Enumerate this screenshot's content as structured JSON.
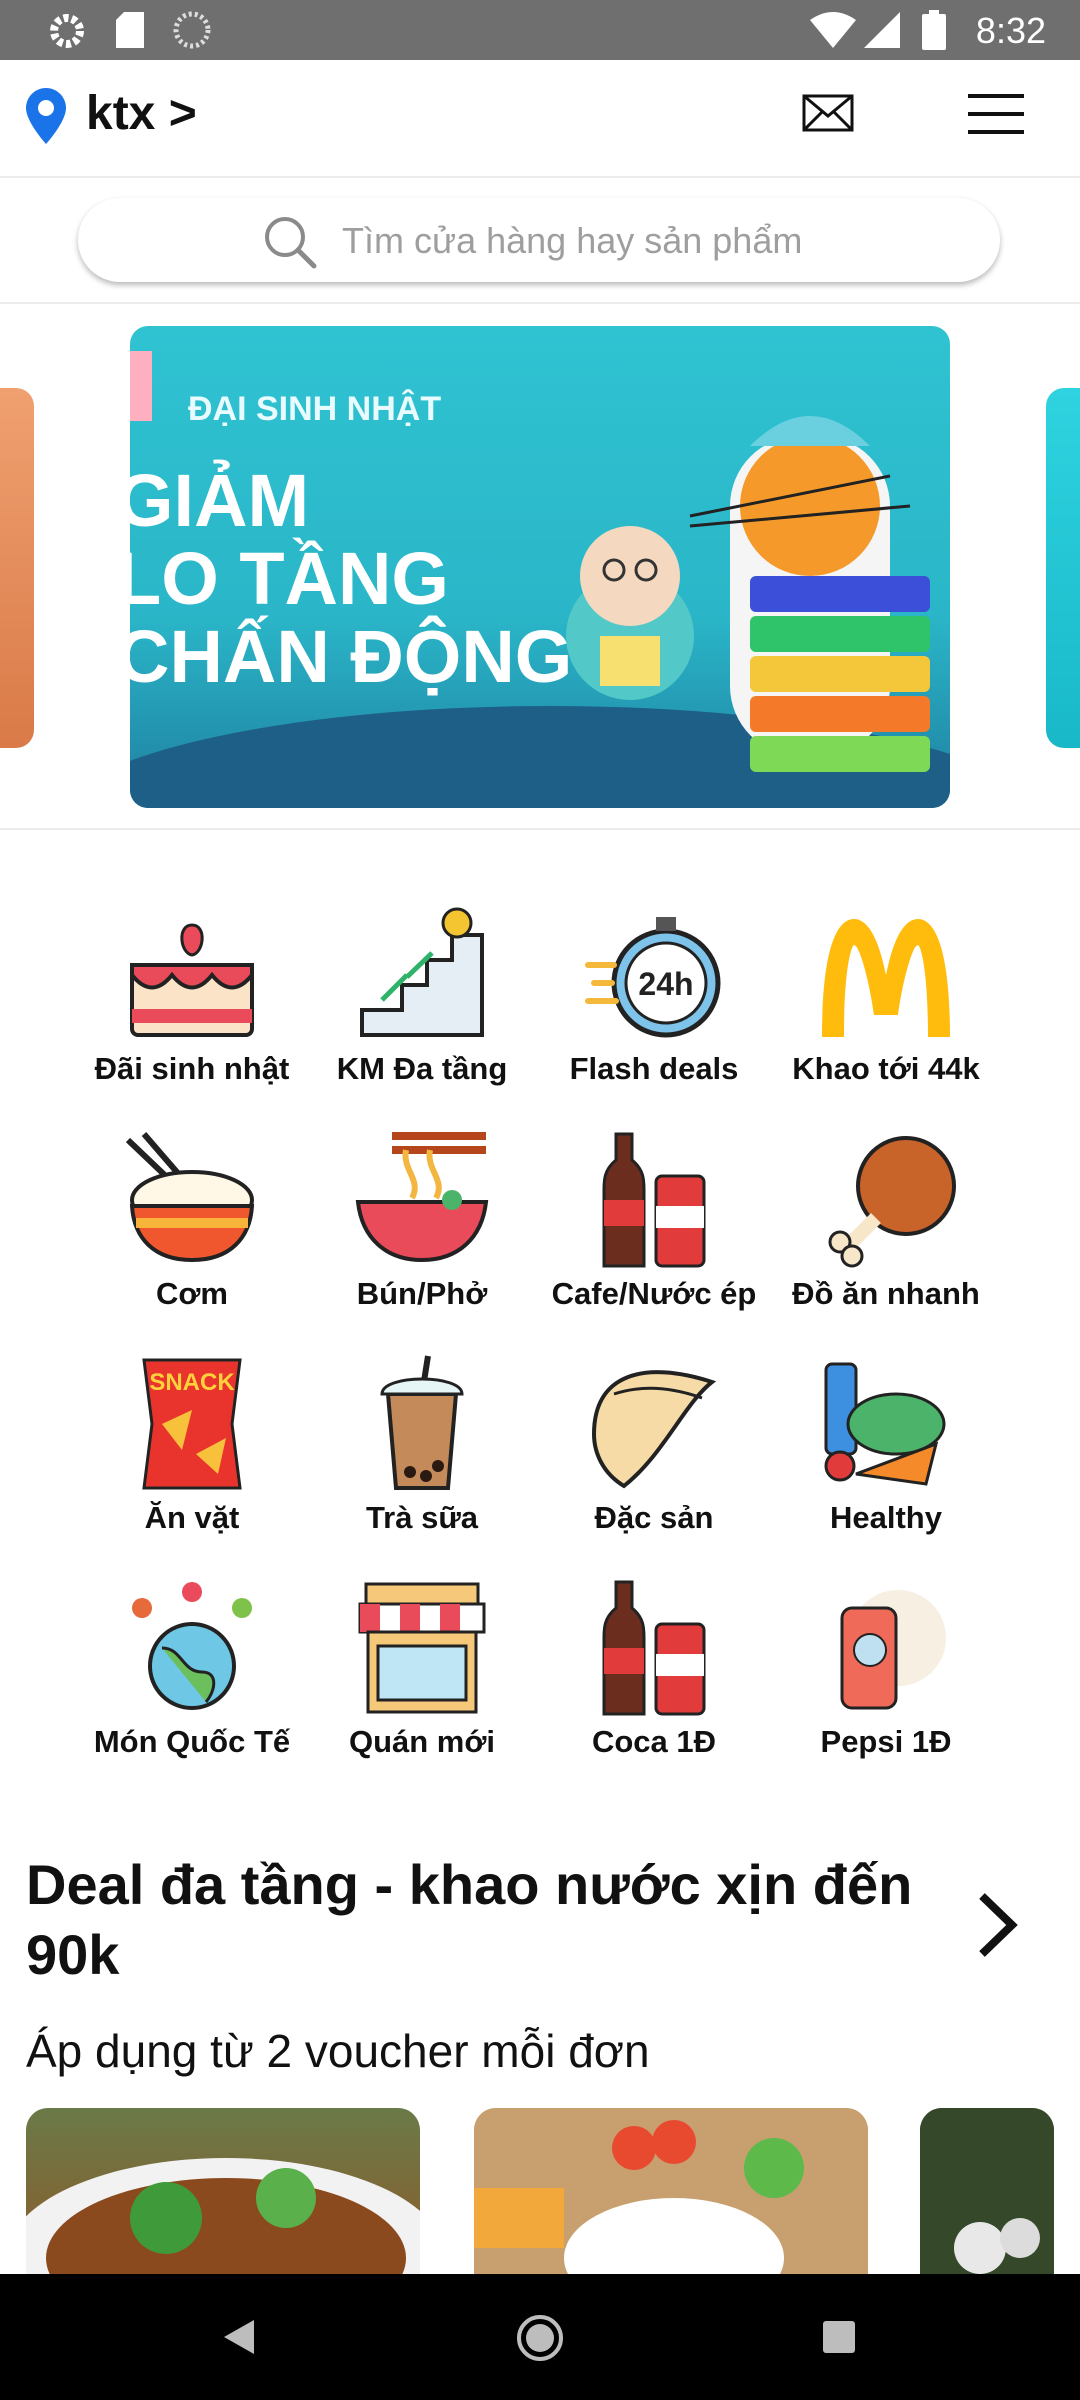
{
  "status_bar": {
    "time": "8:32"
  },
  "header": {
    "location_label": "ktx >"
  },
  "search": {
    "placeholder": "Tìm cửa hàng hay sản phẩm"
  },
  "banner": {
    "tag": "ĐẠI SINH NHẬT",
    "headline": "GIẢM\nLO TẦNG\nCHẤN ĐỘNG"
  },
  "categories": [
    {
      "label": "Đãi sinh nhật",
      "icon": "birthday-cake-icon"
    },
    {
      "label": "KM Đa tầng",
      "icon": "stairs-icon"
    },
    {
      "label": "Flash deals",
      "icon": "stopwatch-24h-icon"
    },
    {
      "label": "Khao tới 44k",
      "icon": "mcdonalds-logo-icon"
    },
    {
      "label": "Cơm",
      "icon": "rice-bowl-icon"
    },
    {
      "label": "Bún/Phở",
      "icon": "noodle-bowl-icon"
    },
    {
      "label": "Cafe/Nước ép",
      "icon": "soda-drinks-icon"
    },
    {
      "label": "Đồ ăn nhanh",
      "icon": "chicken-leg-icon"
    },
    {
      "label": "Ăn vặt",
      "icon": "snack-bag-icon"
    },
    {
      "label": "Trà sữa",
      "icon": "bubble-tea-icon"
    },
    {
      "label": "Đặc sản",
      "icon": "dumpling-icon"
    },
    {
      "label": "Healthy",
      "icon": "healthy-food-icon"
    },
    {
      "label": "Món Quốc Tế",
      "icon": "globe-food-icon"
    },
    {
      "label": "Quán mới",
      "icon": "storefront-icon"
    },
    {
      "label": "Coca 1Đ",
      "icon": "cola-icon"
    },
    {
      "label": "Pepsi 1Đ",
      "icon": "pepsi-can-icon"
    }
  ],
  "deal_section": {
    "title": "Deal đa tầng - khao nước xịn đến 90k",
    "subtitle": "Áp dụng từ 2 voucher mỗi đơn"
  },
  "colors": {
    "accent_blue": "#1a73e8",
    "mcd_yellow": "#ffbc0d"
  }
}
